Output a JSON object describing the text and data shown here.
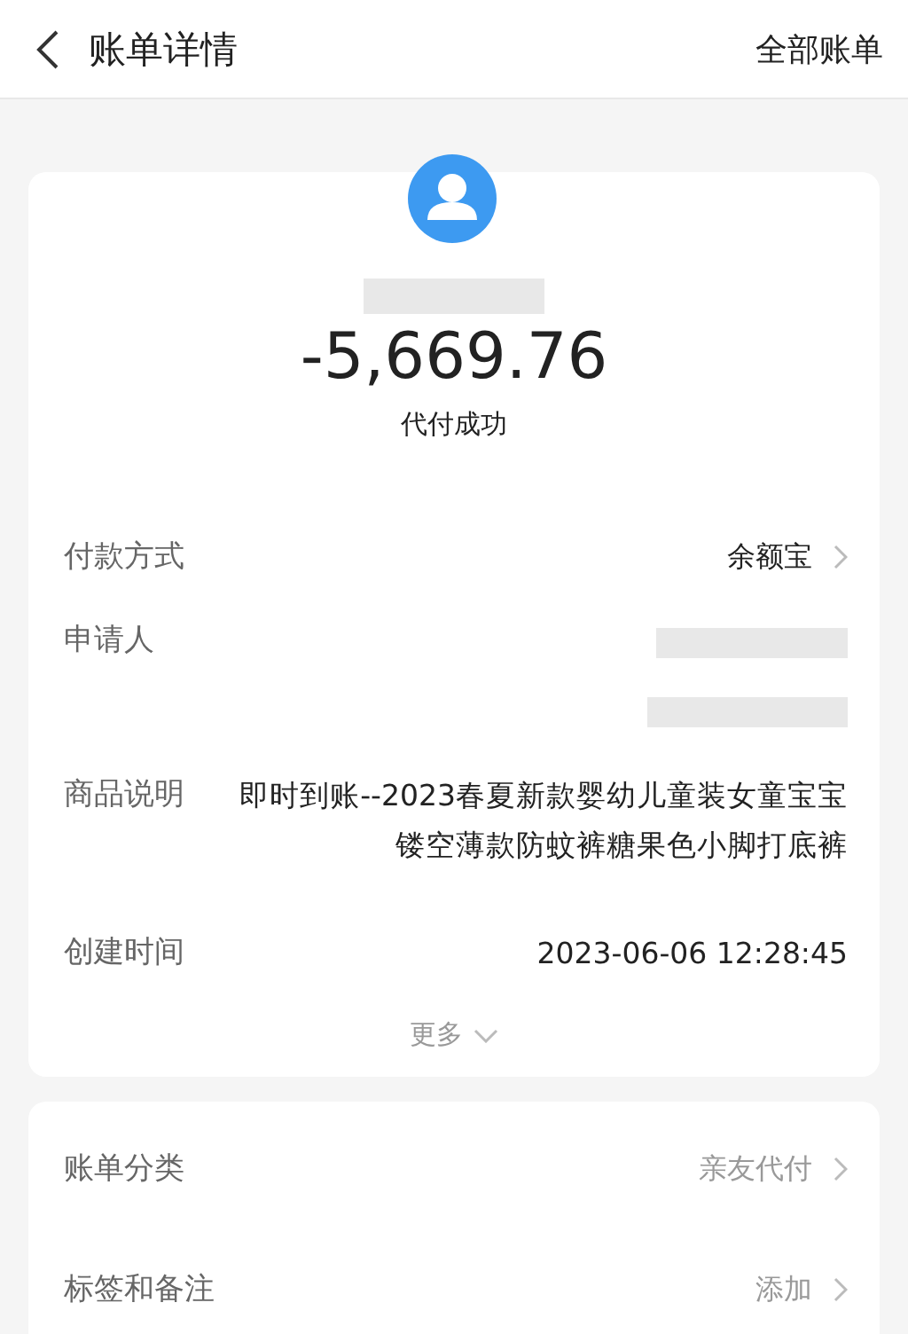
{
  "header": {
    "title": "账单详情",
    "action": "全部账单"
  },
  "summary": {
    "amount": "-5,669.76",
    "status": "代付成功"
  },
  "details": [
    {
      "kind": "link",
      "label": "付款方式",
      "value": "余额宝"
    },
    {
      "kind": "redacted",
      "label": "申请人"
    },
    {
      "kind": "text",
      "label": "商品说明",
      "value": "即时到账--2023春夏新款婴幼儿童装女童宝宝镂空薄款防蚊裤糖果色小脚打底裤"
    },
    {
      "kind": "text",
      "label": "创建时间",
      "value": "2023-06-06 12:28:45"
    }
  ],
  "more": "更多",
  "extras": [
    {
      "label": "账单分类",
      "value": "亲友代付"
    },
    {
      "label": "标签和备注",
      "value": "添加"
    }
  ]
}
